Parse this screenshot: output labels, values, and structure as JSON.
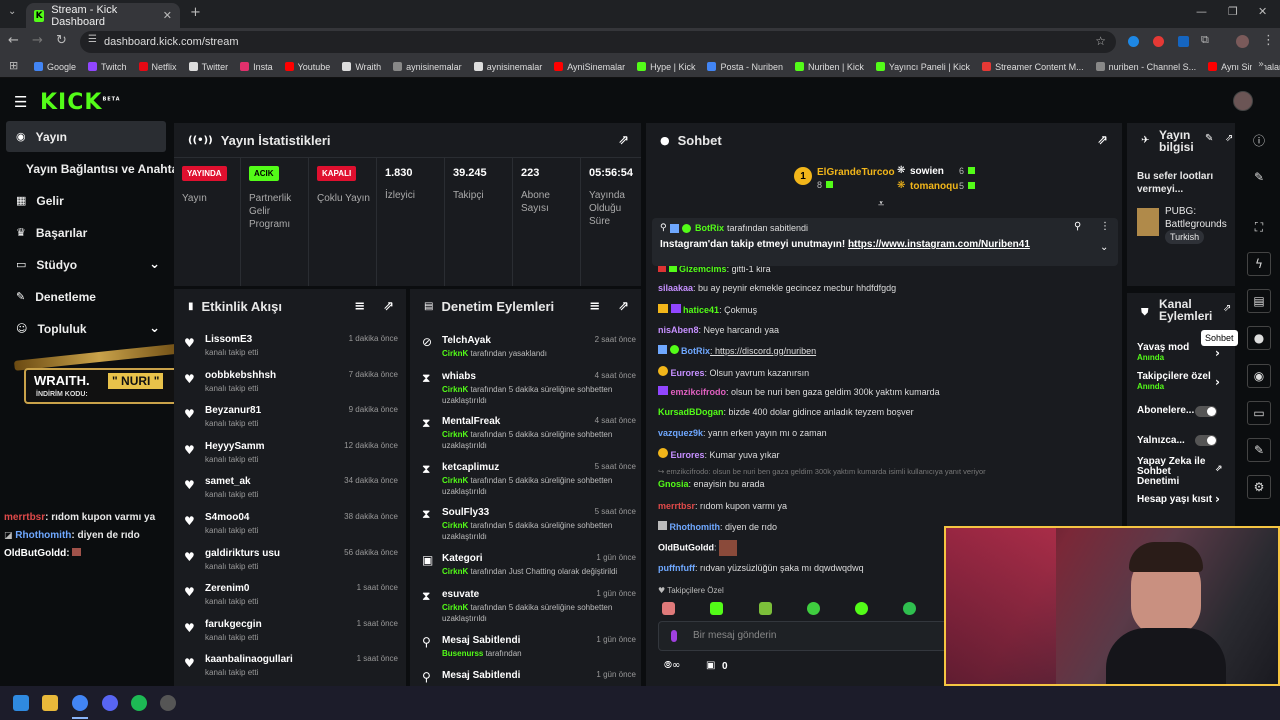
{
  "browser": {
    "tab_title": "Stream - Kick Dashboard",
    "url": "dashboard.kick.com/stream",
    "bookmarks": [
      {
        "label": "Google",
        "color": "#4285f4"
      },
      {
        "label": "Twitch",
        "color": "#9146ff"
      },
      {
        "label": "Netflix",
        "color": "#e50914"
      },
      {
        "label": "Twitter",
        "color": "#dddddd"
      },
      {
        "label": "Insta",
        "color": "#e1306c"
      },
      {
        "label": "Youtube",
        "color": "#ff0000"
      },
      {
        "label": "Wraith",
        "color": "#dddddd"
      },
      {
        "label": "aynisinemalar",
        "color": "#888888"
      },
      {
        "label": "aynisinemalar",
        "color": "#dddddd"
      },
      {
        "label": "AyniSinemalar",
        "color": "#ff0000"
      },
      {
        "label": "Hype | Kick",
        "color": "#53fc18"
      },
      {
        "label": "Posta - Nuriben",
        "color": "#4285f4"
      },
      {
        "label": "Nuriben | Kick",
        "color": "#53fc18"
      },
      {
        "label": "Yayıncı Paneli | Kick",
        "color": "#53fc18"
      },
      {
        "label": "Streamer Content M...",
        "color": "#e53935"
      },
      {
        "label": "nuriben - Channel S...",
        "color": "#888888"
      },
      {
        "label": "Aynı Sinemalar - Ça...",
        "color": "#ff0000"
      }
    ]
  },
  "sidebar": {
    "items": [
      {
        "label": "Yayın",
        "icon": "broadcast-icon"
      },
      {
        "label": "Yayın Bağlantısı ve Anahtarı",
        "icon": ""
      },
      {
        "label": "Gelir",
        "icon": "chart-icon"
      },
      {
        "label": "Başarılar",
        "icon": "trophy-icon"
      },
      {
        "label": "Stüdyo",
        "icon": "studio-icon"
      },
      {
        "label": "Denetleme",
        "icon": "wrench-icon"
      },
      {
        "label": "Topluluk",
        "icon": "community-icon"
      }
    ],
    "promo": {
      "brand": "WRAITH.",
      "name": "\" NURI \"",
      "code_label": "İNDİRİM KODU:"
    },
    "overlay_chat": [
      {
        "user": "merrtbsr",
        "text": ": rıdom kupon varmı ya",
        "color": "#e04a4a"
      },
      {
        "user": "Rhothomith",
        "text": ": diyen de rıdo",
        "color": "#6fa8ff"
      },
      {
        "user": "OldButGoldd",
        "text": ": ",
        "color": "#ffffff"
      }
    ]
  },
  "stats": {
    "title": "Yayın İstatistikleri",
    "badges": [
      {
        "badge": "YAYINDA",
        "label": "Yayın",
        "bg": "#e0102f",
        "fg": "#ffffff"
      },
      {
        "badge": "ACIK",
        "label": "Partnerlik Gelir Programı",
        "bg": "#53fc18",
        "fg": "#000000"
      },
      {
        "badge": "KAPALI",
        "label": "Çoklu Yayın",
        "bg": "#e0102f",
        "fg": "#ffffff"
      }
    ],
    "values": [
      {
        "value": "1.830",
        "label": "İzleyici"
      },
      {
        "value": "39.245",
        "label": "Takipçi"
      },
      {
        "value": "223",
        "label": "Abone Sayısı"
      },
      {
        "value": "05:56:54",
        "label": "Yayında Olduğu Süre"
      }
    ]
  },
  "activity": {
    "title": "Etkinlik Akışı",
    "items": [
      {
        "name": "LissomE3",
        "sub": "kanalı takip etti",
        "time": "1 dakika önce"
      },
      {
        "name": "oobbkebshhsh",
        "sub": "kanalı takip etti",
        "time": "7 dakika önce"
      },
      {
        "name": "Beyzanur81",
        "sub": "kanalı takip etti",
        "time": "9 dakika önce"
      },
      {
        "name": "HeyyySamm",
        "sub": "kanalı takip etti",
        "time": "12 dakika önce"
      },
      {
        "name": "samet_ak",
        "sub": "kanalı takip etti",
        "time": "34 dakika önce"
      },
      {
        "name": "S4moo04",
        "sub": "kanalı takip etti",
        "time": "38 dakika önce"
      },
      {
        "name": "galdirikturs usu",
        "sub": "kanalı takip etti",
        "time": "56 dakika önce"
      },
      {
        "name": "Zerenim0",
        "sub": "kanalı takip etti",
        "time": "1 saat önce"
      },
      {
        "name": "farukgecgin",
        "sub": "kanalı takip etti",
        "time": "1 saat önce"
      },
      {
        "name": "kaanbalinaogullari",
        "sub": "kanalı takip etti",
        "time": "1 saat önce"
      }
    ]
  },
  "moderation": {
    "title": "Denetim Eylemleri",
    "items": [
      {
        "icon": "ban-icon",
        "name": "TelchAyak",
        "mod": "CirknK",
        "sub": " tarafından yasaklandı",
        "time": "2 saat önce"
      },
      {
        "icon": "timeout-icon",
        "name": "whiabs",
        "mod": "CirknK",
        "sub": " tarafından 5 dakika süreliğine sohbetten uzaklaştırıldı",
        "time": "4 saat önce"
      },
      {
        "icon": "timeout-icon",
        "name": "MentalFreak",
        "mod": "CirknK",
        "sub": " tarafından 5 dakika süreliğine sohbetten uzaklaştırıldı",
        "time": "4 saat önce"
      },
      {
        "icon": "timeout-icon",
        "name": "ketcaplimuz",
        "mod": "CirknK",
        "sub": " tarafından 5 dakika süreliğine sohbetten uzaklaştırıldı",
        "time": "5 saat önce"
      },
      {
        "icon": "timeout-icon",
        "name": "SoulFly33",
        "mod": "CirknK",
        "sub": " tarafından 5 dakika süreliğine sohbetten uzaklaştırıldı",
        "time": "5 saat önce"
      },
      {
        "icon": "category-icon",
        "name": "Kategori",
        "mod": "CirknK",
        "sub": " tarafından Just Chatting olarak değiştirildi",
        "time": "1 gün önce"
      },
      {
        "icon": "timeout-icon",
        "name": "esuvate",
        "mod": "CirknK",
        "sub": " tarafından 5 dakika süreliğine sohbetten uzaklaştırıldı",
        "time": "1 gün önce"
      },
      {
        "icon": "pin-icon",
        "name": "Mesaj Sabitlendi",
        "mod": "Busenurss",
        "sub": " tarafından",
        "time": "1 gün önce"
      },
      {
        "icon": "pin-icon",
        "name": "Mesaj Sabitlendi",
        "mod": "",
        "sub": "",
        "time": "1 gün önce"
      }
    ]
  },
  "chat": {
    "title": "Sohbet",
    "top_gifters": [
      {
        "name": "ElGrandeTurcoo",
        "count": "8",
        "rank": "1"
      },
      {
        "name": "sowien",
        "count": "6",
        "rank": ""
      },
      {
        "name": "tomanoqu",
        "count": "5",
        "rank": ""
      }
    ],
    "pinned": {
      "by": "BotRix",
      "by_suffix": "tarafından sabitlendi",
      "text": "Instagram'dan takip etmeyi unutmayın! →",
      "link": "https://www.instagram.com/Nuriben41"
    },
    "messages": [
      {
        "user": "Gizemcims",
        "text": ": gitti-1 kira",
        "color": "#53fc18"
      },
      {
        "user": "silaakaa",
        "text": ": bu ay peynir ekmekle gecincez mecbur hhdfdfgdg",
        "color": "#c690ff"
      },
      {
        "user": "hatice41",
        "text": ": Çokmuş",
        "color": "#53fc18"
      },
      {
        "user": "nisAben8",
        "text": ": Neye harcandı yaa",
        "color": "#c690ff"
      },
      {
        "user": "BotRix",
        "text": ": https://discord.gg/nuriben",
        "color": "#6fa8ff"
      },
      {
        "user": "Eurores",
        "text": ": Olsun yavrum kazanırsın",
        "color": "#c690ff"
      },
      {
        "user": "emzikcifrodo",
        "text": ": olsun be nuri ben gaza geldim 300k yaktım kumarda",
        "color": "#e060c0"
      },
      {
        "user": "KursadBDogan",
        "text": ": bizde 400 dolar gidince anladık teyzem boşver",
        "color": "#53fc18"
      },
      {
        "user": "vazquez9k",
        "text": ": yarın erken yayın mı o zaman",
        "color": "#6fa8ff"
      },
      {
        "user": "Eurores",
        "text": ": Kumar yuva yıkar",
        "color": "#c690ff"
      },
      {
        "user": "",
        "text": "↪ emzikcifrodo: olsun be nuri ben gaza geldim 300k yaktım kumarda isimli kullanıcıya yanıt veriyor",
        "color": "#777777"
      },
      {
        "user": "Gnosia",
        "text": ": enayisin bu arada",
        "color": "#53fc18"
      },
      {
        "user": "merrtbsr",
        "text": ": rıdom kupon varmı ya",
        "color": "#e04a4a"
      },
      {
        "user": "Rhothomith",
        "text": ": diyen de rıdo",
        "color": "#6fa8ff"
      },
      {
        "user": "OldButGoldd",
        "text": ":",
        "color": "#ffffff"
      },
      {
        "user": "puffnfuff",
        "text": ": rıdvan yüzsüzlüğün şaka mı dqwdwqdwq",
        "color": "#6fa8ff"
      }
    ],
    "followers_only": "Takipçilere Özel",
    "input_placeholder": "Bir mesaj gönderin",
    "footer_count": "0"
  },
  "channel": {
    "stream_info_title": "Yayın bilgisi",
    "stream_title": "Bu sefer lootları vermeyi...",
    "category": "PUBG: Battlegrounds",
    "tag": "Turkish",
    "channel_title": "Kanal Eylemleri",
    "rows": [
      {
        "label": "Yavaş mod",
        "sub": "Anında",
        "control": "chevron"
      },
      {
        "label": "Takipçilere özel",
        "sub": "Anında",
        "control": "chevron"
      },
      {
        "label": "Abonelere...",
        "sub": "",
        "control": "toggle"
      },
      {
        "label": "Yalnızca...",
        "sub": "",
        "control": "toggle"
      },
      {
        "label": "Yapay Zeka ile Sohbet Denetimi",
        "sub": "",
        "control": "external"
      },
      {
        "label": "Hesap yaşı kısıt",
        "sub": "",
        "control": "chevron"
      }
    ],
    "tooltip": "Sohbet"
  },
  "colors": {
    "accent": "#53fc18",
    "panel": "#191b1f",
    "bg": "#0b0d0f"
  }
}
